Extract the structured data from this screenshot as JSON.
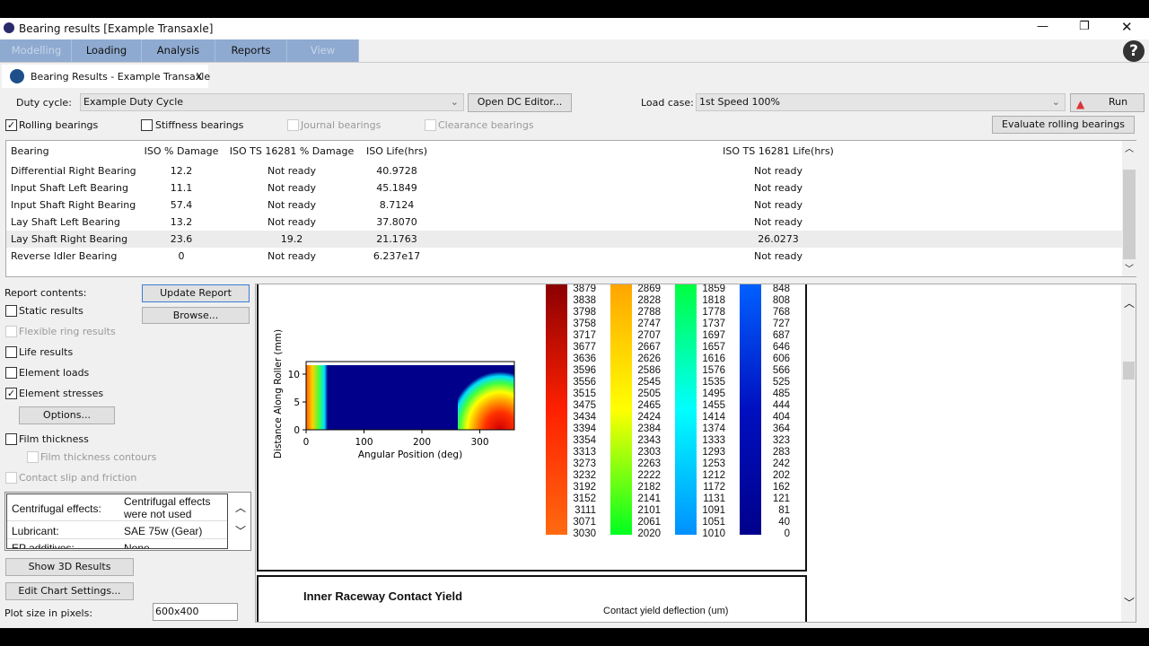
{
  "window": {
    "title": "Bearing results [Example Transaxle]",
    "controls": [
      "minimize",
      "restore",
      "close"
    ]
  },
  "menu": {
    "tabs": [
      {
        "label": "Modelling",
        "enabled": false
      },
      {
        "label": "Loading",
        "enabled": true
      },
      {
        "label": "Analysis",
        "enabled": true
      },
      {
        "label": "Reports",
        "enabled": true
      },
      {
        "label": "View",
        "enabled": false
      }
    ]
  },
  "doc_tab": {
    "label": "Bearing Results - Example Transaxle",
    "close": "X"
  },
  "controls": {
    "duty_cycle_label": "Duty cycle:",
    "duty_cycle_value": "Example Duty Cycle",
    "open_dc_editor": "Open DC Editor...",
    "load_case_label": "Load case:",
    "load_case_value": "1st Speed 100%",
    "run": "Run",
    "evaluate": "Evaluate rolling bearings",
    "checks": [
      {
        "label": "Rolling bearings",
        "checked": true,
        "enabled": true
      },
      {
        "label": "Stiffness bearings",
        "checked": false,
        "enabled": true
      },
      {
        "label": "Journal bearings",
        "checked": false,
        "enabled": false
      },
      {
        "label": "Clearance bearings",
        "checked": false,
        "enabled": false
      }
    ]
  },
  "table": {
    "headers": [
      "Bearing",
      "ISO % Damage",
      "ISO TS 16281 % Damage",
      "ISO Life(hrs)",
      "ISO TS 16281 Life(hrs)"
    ],
    "rows": [
      [
        "Differential Right Bearing",
        "12.2",
        "Not ready",
        "40.9728",
        "Not ready"
      ],
      [
        "Input Shaft Left Bearing",
        "11.1",
        "Not ready",
        "45.1849",
        "Not ready"
      ],
      [
        "Input Shaft Right Bearing",
        "57.4",
        "Not ready",
        "8.7124",
        "Not ready"
      ],
      [
        "Lay Shaft Left Bearing",
        "13.2",
        "Not ready",
        "37.8070",
        "Not ready"
      ],
      [
        "Lay Shaft Right Bearing",
        "23.6",
        "19.2",
        "21.1763",
        "26.0273"
      ],
      [
        "Reverse Idler Bearing",
        "0",
        "Not ready",
        "6.237e17",
        "Not ready"
      ]
    ],
    "selected_row": 4
  },
  "report": {
    "contents_label": "Report contents:",
    "update": "Update Report",
    "browse": "Browse...",
    "options": "Options...",
    "items": [
      {
        "label": "Static results",
        "checked": false,
        "enabled": true
      },
      {
        "label": "Flexible ring results",
        "checked": false,
        "enabled": false
      },
      {
        "label": "Life results",
        "checked": false,
        "enabled": true
      },
      {
        "label": "Element loads",
        "checked": false,
        "enabled": true
      },
      {
        "label": "Element stresses",
        "checked": true,
        "enabled": true
      },
      {
        "label": "Film thickness",
        "checked": false,
        "enabled": true
      },
      {
        "label": "Film thickness contours",
        "checked": false,
        "enabled": false
      },
      {
        "label": "Contact slip and friction",
        "checked": false,
        "enabled": false
      }
    ],
    "props": [
      [
        "Centrifugal effects:",
        "Centrifugal effects were not used"
      ],
      [
        "Lubricant:",
        "SAE 75w (Gear)"
      ],
      [
        "EP additives:",
        "None"
      ]
    ],
    "show3d": "Show 3D Results",
    "edit_chart": "Edit Chart Settings...",
    "plot_size_label": "Plot size in pixels:",
    "plot_size": "600x400"
  },
  "plot": {
    "xlabel": "Angular Position (deg)",
    "ylabel": "Distance Along Roller (mm)",
    "xticks": [
      "0",
      "100",
      "200",
      "300"
    ],
    "yticks": [
      "0",
      "5",
      "10"
    ],
    "colorbar": [
      [
        "3879",
        "3838",
        "3798",
        "3758",
        "3717",
        "3677",
        "3636",
        "3596",
        "3556",
        "3515",
        "3475",
        "3434",
        "3394",
        "3354",
        "3313",
        "3273",
        "3232",
        "3192",
        "3152",
        "3111",
        "3071",
        "3030"
      ],
      [
        "2869",
        "2828",
        "2788",
        "2747",
        "2707",
        "2667",
        "2626",
        "2586",
        "2545",
        "2505",
        "2465",
        "2424",
        "2384",
        "2343",
        "2303",
        "2263",
        "2222",
        "2182",
        "2141",
        "2101",
        "2061",
        "2020"
      ],
      [
        "1859",
        "1818",
        "1778",
        "1737",
        "1697",
        "1657",
        "1616",
        "1576",
        "1535",
        "1495",
        "1455",
        "1414",
        "1374",
        "1333",
        "1293",
        "1253",
        "1212",
        "1172",
        "1131",
        "1091",
        "1051",
        "1010"
      ],
      [
        "848",
        "808",
        "768",
        "727",
        "687",
        "646",
        "606",
        "566",
        "525",
        "485",
        "444",
        "404",
        "364",
        "323",
        "283",
        "242",
        "202",
        "162",
        "121",
        "81",
        "40",
        "0"
      ]
    ],
    "colorbar_gradients": [
      [
        "#8b0000",
        "#ff2000",
        "#ff6a10"
      ],
      [
        "#ffa500",
        "#ffff00",
        "#00ff20"
      ],
      [
        "#00ff40",
        "#00ffff",
        "#0090ff"
      ],
      [
        "#0060ff",
        "#0010c0",
        "#00008b"
      ]
    ]
  },
  "next_plot": {
    "title": "Inner Raceway Contact Yield",
    "subtitle": "Contact yield deflection (um)"
  }
}
